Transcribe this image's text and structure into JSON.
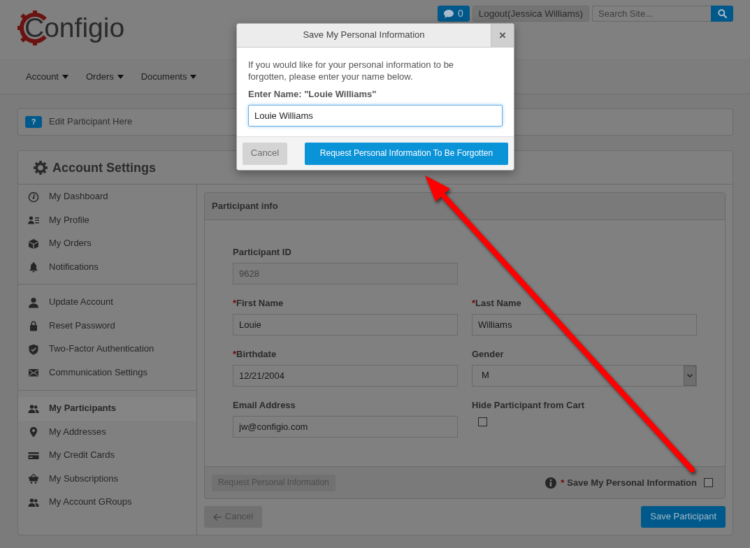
{
  "header": {
    "logo": "Configio",
    "messages_button": {
      "count": "0"
    },
    "logout_button": "Logout(Jessica Williams)",
    "search": {
      "placeholder": "Search Site..."
    }
  },
  "nav": [
    {
      "label": "Account"
    },
    {
      "label": "Orders"
    },
    {
      "label": "Documents"
    }
  ],
  "notice": {
    "badge": "?",
    "text": "Edit Participant Here"
  },
  "account_settings": {
    "title": "Account Settings",
    "sidebar": {
      "groups": [
        {
          "items": [
            {
              "label": "My Dashboard",
              "selected": false
            },
            {
              "label": "My Profile",
              "selected": false
            },
            {
              "label": "My Orders",
              "selected": false
            },
            {
              "label": "Notifications",
              "selected": false
            }
          ]
        },
        {
          "items": [
            {
              "label": "Update Account",
              "selected": false
            },
            {
              "label": "Reset Password",
              "selected": false
            },
            {
              "label": "Two-Factor Authentication",
              "selected": false
            },
            {
              "label": "Communication Settings",
              "selected": false
            }
          ]
        },
        {
          "items": [
            {
              "label": "My Participants",
              "selected": true
            },
            {
              "label": "My Addresses",
              "selected": false
            },
            {
              "label": "My Credit Cards",
              "selected": false
            },
            {
              "label": "My Subscriptions",
              "selected": false
            },
            {
              "label": "My Account GRoups",
              "selected": false
            }
          ]
        }
      ]
    },
    "participant_panel": {
      "title": "Participant info",
      "rows": [
        {
          "fields": [
            {
              "label": "Participant ID",
              "kind": "text",
              "value": "9628",
              "disabled": true
            }
          ]
        },
        {
          "fields": [
            {
              "required_mark": "*",
              "label": "First Name",
              "kind": "text",
              "value": "Louie",
              "disabled": false
            },
            {
              "required_mark": "*",
              "label": "Last Name",
              "kind": "text",
              "value": "Williams",
              "disabled": false
            }
          ]
        },
        {
          "fields": [
            {
              "required_mark": "*",
              "label": "Birthdate",
              "kind": "text",
              "value": "12/21/2004",
              "disabled": false
            },
            {
              "label": "Gender",
              "kind": "select",
              "value": "M",
              "disabled": false
            }
          ]
        },
        {
          "fields": [
            {
              "label": "Email Address",
              "kind": "text",
              "value": "jw@configio.com",
              "disabled": false
            },
            {
              "label": "Hide Participant from Cart",
              "kind": "checkbox",
              "checked": false,
              "disabled": false
            }
          ]
        }
      ],
      "footer": {
        "request_button": {
          "label": "Request Personal Information",
          "disabled": true
        },
        "save_info": {
          "required_mark": "*",
          "label": "Save My Personal Information",
          "checked": false
        }
      }
    },
    "actions": [
      {
        "label": "Cancel",
        "kind": "back"
      },
      {
        "label": "Save Participant",
        "kind": "primary"
      }
    ]
  },
  "modal": {
    "title": "Save My Personal Information",
    "close": "×",
    "message": "If you would like for your personal information to be forgotten, please enter your name below.",
    "prompt": "Enter Name: \"Louie Williams\"",
    "input_value": "Louie Williams",
    "buttons": [
      {
        "label": "Cancel",
        "kind": "secondary"
      },
      {
        "label": "Request Personal Information To Be Forgotten",
        "kind": "primary"
      }
    ]
  }
}
